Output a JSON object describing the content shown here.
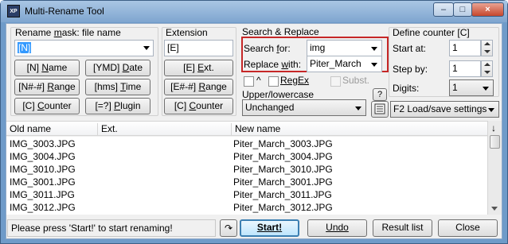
{
  "window": {
    "title": "Multi-Rename Tool",
    "icon_text": "XP",
    "minimize": "–",
    "maximize": "□",
    "close": "×"
  },
  "rename_mask": {
    "label_prefix": "Rename ",
    "label_mn": "m",
    "label_suffix": "ask: file name",
    "value": "[N]",
    "buttons": [
      {
        "hot": "[N]",
        "rest": " Name",
        "ul": "N",
        "pre": "[N] ",
        "post": "ame"
      },
      {
        "pre": "[YMD] ",
        "ul": "D",
        "post": "ate"
      },
      {
        "pre": "[N#-#] ",
        "ul": "R",
        "post": "ange"
      },
      {
        "pre": "[hms] ",
        "ul": "T",
        "post": "ime"
      },
      {
        "pre": "[C] ",
        "ul": "C",
        "post": "ounter"
      },
      {
        "pre": "[=?] ",
        "ul": "P",
        "post": "lugin"
      }
    ]
  },
  "extension": {
    "label": "Extension",
    "value": "[E]",
    "buttons": [
      {
        "pre": "[E] ",
        "ul": "E",
        "post": "xt."
      },
      {
        "pre": "[E#-#] ",
        "ul": "R",
        "post": "ange"
      },
      {
        "pre": "[C] ",
        "ul": "C",
        "post": "ounter"
      }
    ]
  },
  "search_replace": {
    "label": "Search & Replace",
    "search_label_pre": "Search ",
    "search_label_ul": "f",
    "search_label_post": "or:",
    "search_value": "img",
    "replace_label_pre": "Replace ",
    "replace_label_ul": "w",
    "replace_label_post": "ith:",
    "replace_value": "Piter_March",
    "caret_label": "^",
    "regex_label": "RegEx",
    "subst_label": "Subst."
  },
  "case": {
    "label": "Upper/lowercase",
    "value": "Unchanged",
    "help": "?"
  },
  "counter": {
    "label": "Define counter [C]",
    "start_label": "Start at:",
    "start_value": "1",
    "step_label": "Step by:",
    "step_value": "1",
    "digits_label": "Digits:",
    "digits_value": "1"
  },
  "settings_label": "F2 Load/save settings",
  "list": {
    "columns": [
      "Old name",
      "Ext.",
      "New name"
    ],
    "sort_icon": "↓",
    "rows": [
      [
        "IMG_3003.JPG",
        "",
        "Piter_March_3003.JPG"
      ],
      [
        "IMG_3004.JPG",
        "",
        "Piter_March_3004.JPG"
      ],
      [
        "IMG_3010.JPG",
        "",
        "Piter_March_3010.JPG"
      ],
      [
        "IMG_3001.JPG",
        "",
        "Piter_March_3001.JPG"
      ],
      [
        "IMG_3011.JPG",
        "",
        "Piter_March_3011.JPG"
      ],
      [
        "IMG_3012.JPG",
        "",
        "Piter_March_3012.JPG"
      ]
    ]
  },
  "footer": {
    "status": "Please press 'Start!' to start renaming!",
    "undo_icon": "↷",
    "start": "Start!",
    "undo": "Undo",
    "result": "Result list",
    "close": "Close"
  }
}
